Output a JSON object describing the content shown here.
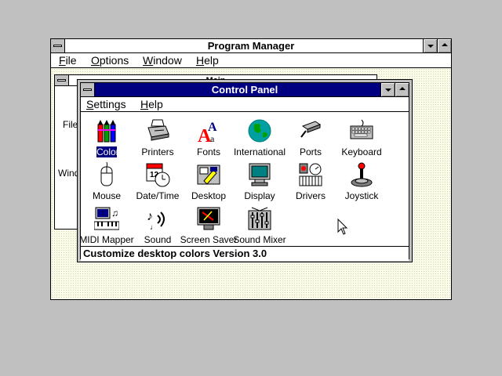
{
  "program_manager": {
    "title": "Program Manager",
    "menu": [
      {
        "first": "F",
        "rest": "ile"
      },
      {
        "first": "O",
        "rest": "ptions"
      },
      {
        "first": "W",
        "rest": "indow"
      },
      {
        "first": "H",
        "rest": "elp"
      }
    ],
    "main_group": {
      "title": "Main",
      "visible_labels": [
        "File",
        "Wind"
      ]
    }
  },
  "control_panel": {
    "title": "Control Panel",
    "menu": [
      {
        "first": "S",
        "rest": "ettings"
      },
      {
        "first": "H",
        "rest": "elp"
      }
    ],
    "items": [
      {
        "label": "Color",
        "icon": "color-crayons-icon",
        "selected": true
      },
      {
        "label": "Printers",
        "icon": "printer-icon"
      },
      {
        "label": "Fonts",
        "icon": "fonts-icon"
      },
      {
        "label": "International",
        "icon": "globe-icon"
      },
      {
        "label": "Ports",
        "icon": "ports-plug-icon"
      },
      {
        "label": "Keyboard",
        "icon": "keyboard-icon"
      },
      {
        "label": "Mouse",
        "icon": "mouse-icon"
      },
      {
        "label": "Date/Time",
        "icon": "calendar-clock-icon"
      },
      {
        "label": "Desktop",
        "icon": "desktop-icon"
      },
      {
        "label": "Display",
        "icon": "monitor-icon"
      },
      {
        "label": "Drivers",
        "icon": "drivers-icon"
      },
      {
        "label": "Joystick",
        "icon": "joystick-icon"
      },
      {
        "label": "MIDI Mapper",
        "icon": "midi-mapper-icon"
      },
      {
        "label": "Sound",
        "icon": "sound-icon"
      },
      {
        "label": "Screen Saver",
        "icon": "screen-saver-icon"
      },
      {
        "label": "Sound Mixer",
        "icon": "sound-mixer-icon"
      }
    ],
    "status": "Customize desktop colors Version 3.0"
  },
  "colors": {
    "active_title": "#000080",
    "desktop": "#c0c0c0",
    "selection": "#000080"
  }
}
